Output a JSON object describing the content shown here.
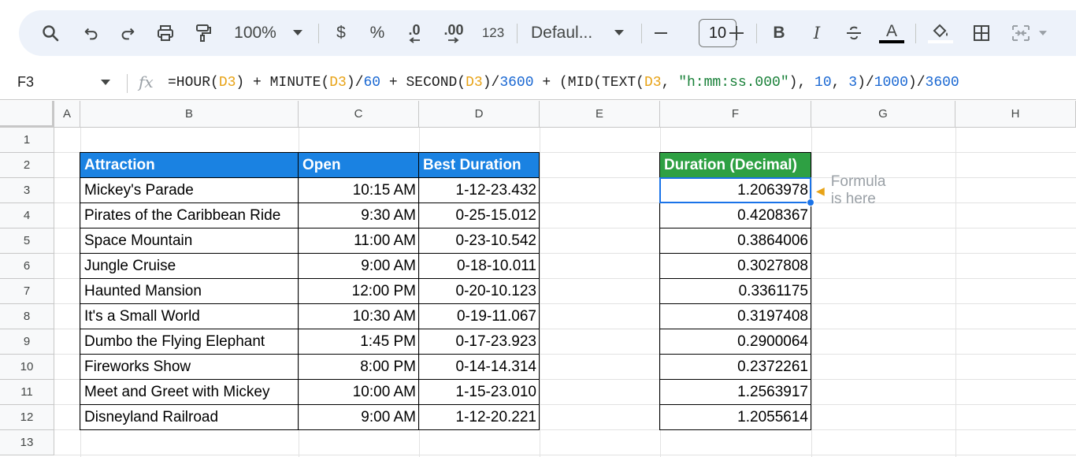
{
  "toolbar": {
    "zoom": "100%",
    "currency_label": "$",
    "percent_label": "%",
    "decrease_decimal_label": ".0",
    "increase_decimal_label": ".00",
    "more_formats_label": "123",
    "font_name": "Defaul...",
    "font_size": "10",
    "bold_label": "B",
    "italic_label": "I",
    "text_color_label": "A"
  },
  "formula_bar": {
    "cell_ref": "F3",
    "fx_label": "fx",
    "formula_parts": [
      {
        "t": "=HOUR(",
        "c": "plain"
      },
      {
        "t": "D3",
        "c": "ref"
      },
      {
        "t": ") + MINUTE(",
        "c": "plain"
      },
      {
        "t": "D3",
        "c": "ref"
      },
      {
        "t": ")/",
        "c": "plain"
      },
      {
        "t": "60",
        "c": "num"
      },
      {
        "t": " + SECOND(",
        "c": "plain"
      },
      {
        "t": "D3",
        "c": "ref"
      },
      {
        "t": ")/",
        "c": "plain"
      },
      {
        "t": "3600",
        "c": "num"
      },
      {
        "t": " + (MID(TEXT(",
        "c": "plain"
      },
      {
        "t": "D3",
        "c": "ref"
      },
      {
        "t": ", ",
        "c": "plain"
      },
      {
        "t": "\"h:mm:ss.000\"",
        "c": "str"
      },
      {
        "t": "), ",
        "c": "plain"
      },
      {
        "t": "10",
        "c": "num"
      },
      {
        "t": ", ",
        "c": "plain"
      },
      {
        "t": "3",
        "c": "num"
      },
      {
        "t": ")/",
        "c": "plain"
      },
      {
        "t": "1000",
        "c": "num"
      },
      {
        "t": ")/",
        "c": "plain"
      },
      {
        "t": "3600",
        "c": "num"
      }
    ]
  },
  "columns": [
    "A",
    "B",
    "C",
    "D",
    "E",
    "F",
    "G",
    "H"
  ],
  "rows": [
    "1",
    "2",
    "3",
    "4",
    "5",
    "6",
    "7",
    "8",
    "9",
    "10",
    "11",
    "12",
    "13"
  ],
  "table": {
    "headers": {
      "attraction": "Attraction",
      "open": "Open",
      "best_duration": "Best Duration"
    },
    "rows": [
      {
        "attraction": "Mickey's Parade",
        "open": "10:15 AM",
        "best_duration": "1-12-23.432"
      },
      {
        "attraction": "Pirates of the Caribbean Ride",
        "open": "9:30 AM",
        "best_duration": "0-25-15.012"
      },
      {
        "attraction": "Space Mountain",
        "open": "11:00 AM",
        "best_duration": "0-23-10.542"
      },
      {
        "attraction": "Jungle Cruise",
        "open": "9:00 AM",
        "best_duration": "0-18-10.011"
      },
      {
        "attraction": "Haunted Mansion",
        "open": "12:00 PM",
        "best_duration": "0-20-10.123"
      },
      {
        "attraction": "It's a Small World",
        "open": "10:30 AM",
        "best_duration": "0-19-11.067"
      },
      {
        "attraction": "Dumbo the Flying Elephant",
        "open": "1:45 PM",
        "best_duration": "0-17-23.923"
      },
      {
        "attraction": "Fireworks Show",
        "open": "8:00 PM",
        "best_duration": "0-14-14.314"
      },
      {
        "attraction": "Meet and Greet with Mickey",
        "open": "10:00 AM",
        "best_duration": "1-15-23.010"
      },
      {
        "attraction": "Disneyland Railroad",
        "open": "9:00 AM",
        "best_duration": "1-12-20.221"
      }
    ]
  },
  "decimal": {
    "header": "Duration (Decimal)",
    "values": [
      "1.2063978",
      "0.4208367",
      "0.3864006",
      "0.3027808",
      "0.3361175",
      "0.3197408",
      "0.2900064",
      "0.2372261",
      "1.2563917",
      "1.2055614"
    ]
  },
  "note": {
    "text": "Formula is here"
  },
  "colors": {
    "header_blue": "#1a82e2",
    "header_green": "#2ea043",
    "selection": "#1a73e8"
  }
}
